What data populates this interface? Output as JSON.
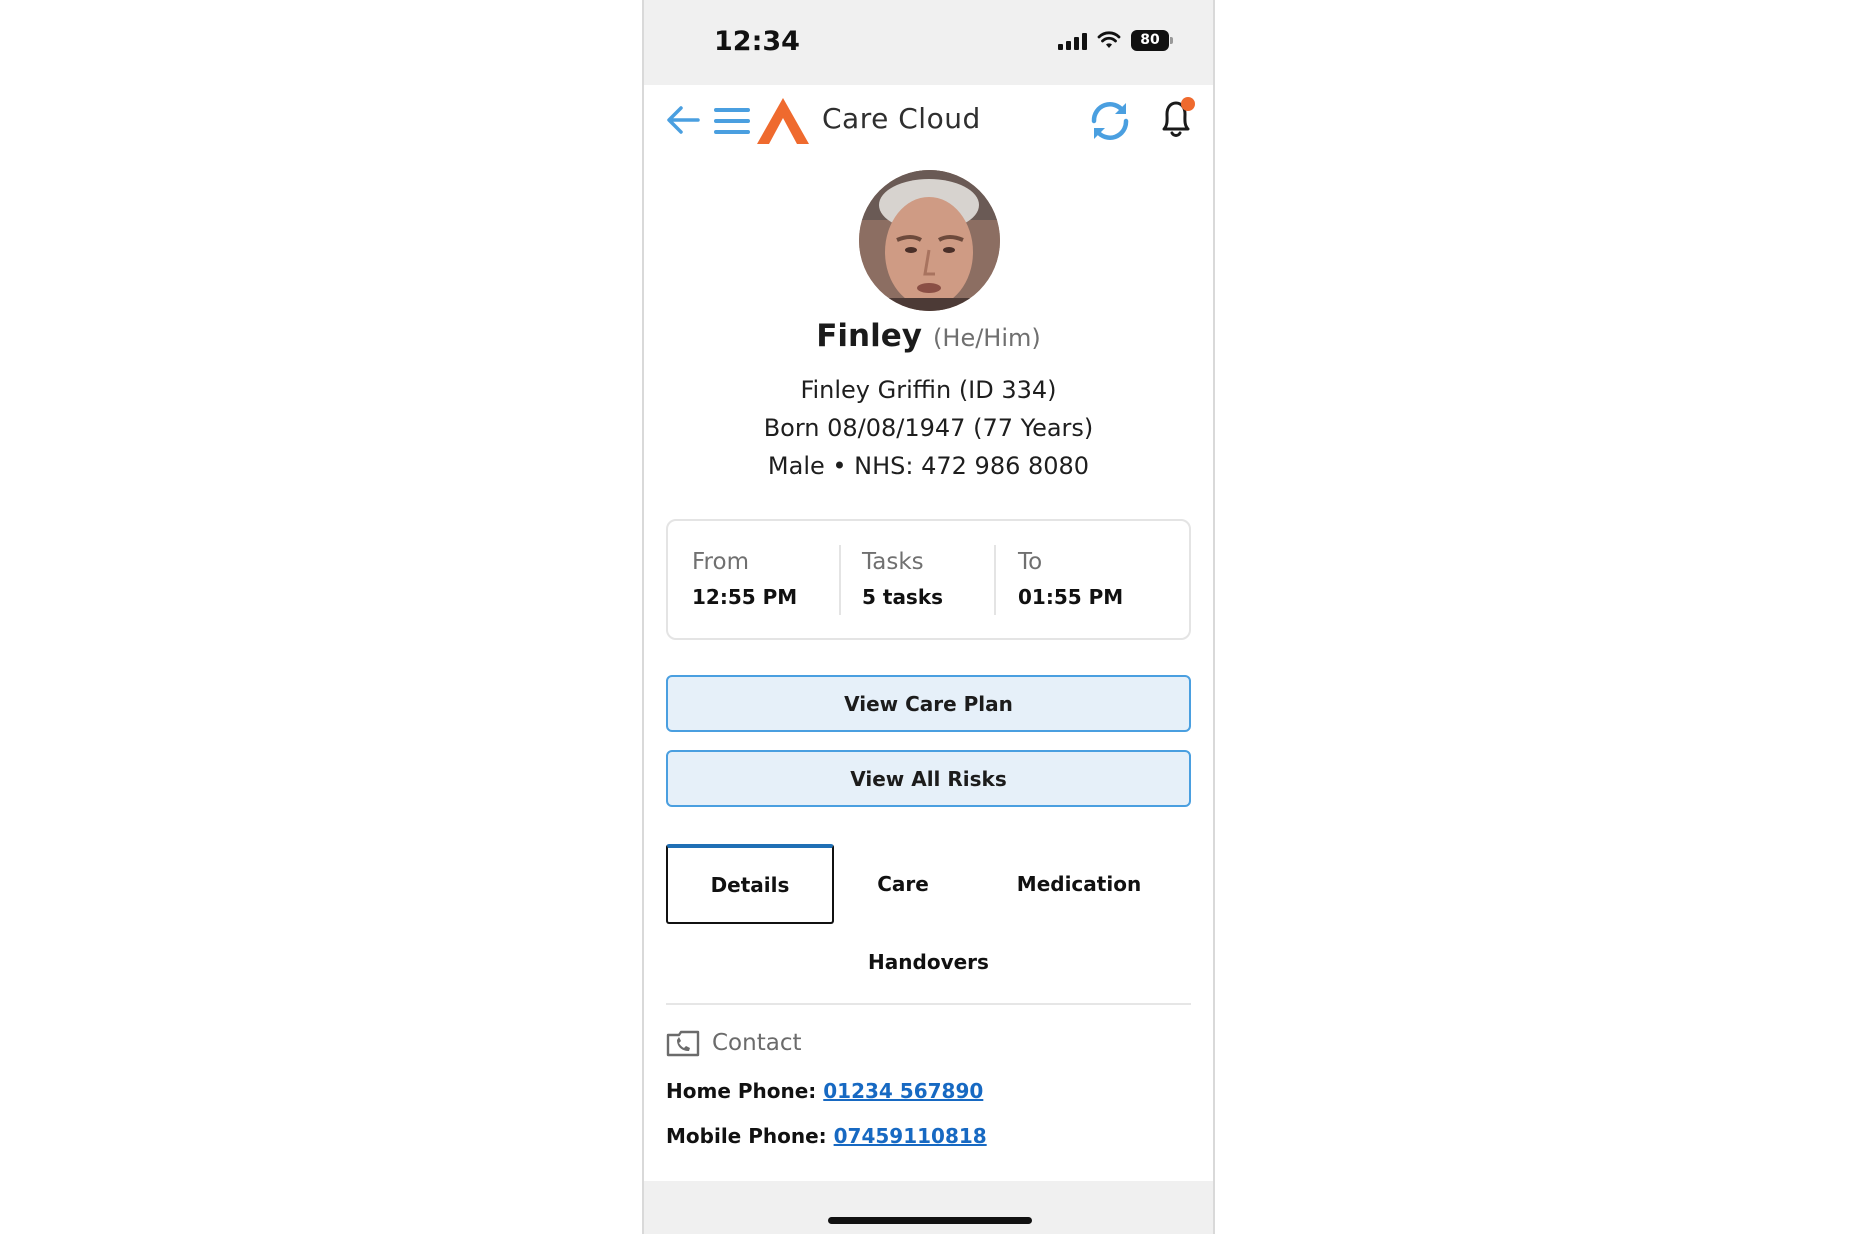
{
  "status_bar": {
    "time": "12:34",
    "battery": "80"
  },
  "app_bar": {
    "title": "Care Cloud"
  },
  "colors": {
    "accent": "#4a9fe0",
    "brand_orange": "#ef6a2e",
    "link": "#1769c2",
    "notification_dot": "#ef6a2e"
  },
  "icons": [
    "back-arrow-icon",
    "menu-icon",
    "app-logo",
    "sync-icon",
    "bell-icon",
    "phone-icon"
  ],
  "profile": {
    "name": "Finley",
    "pronouns": "(He/Him)",
    "full_name_id": "Finley Griffin (ID 334)",
    "born": "Born 08/08/1947 (77 Years)",
    "gender_nhs": "Male • NHS: 472 986 8080"
  },
  "visit": {
    "from_label": "From",
    "from_value": "12:55 PM",
    "tasks_label": "Tasks",
    "tasks_value": "5 tasks",
    "to_label": "To",
    "to_value": "01:55 PM"
  },
  "buttons": {
    "care_plan": "View Care Plan",
    "all_risks": "View All Risks"
  },
  "tabs": [
    {
      "label": "Details",
      "active": true
    },
    {
      "label": "Care",
      "active": false
    },
    {
      "label": "Medication",
      "active": false
    },
    {
      "label": "Handovers",
      "active": false
    }
  ],
  "contact": {
    "heading": "Contact",
    "home_label": "Home Phone:",
    "home_value": "01234 567890",
    "mobile_label": "Mobile Phone:",
    "mobile_value": "07459110818"
  }
}
